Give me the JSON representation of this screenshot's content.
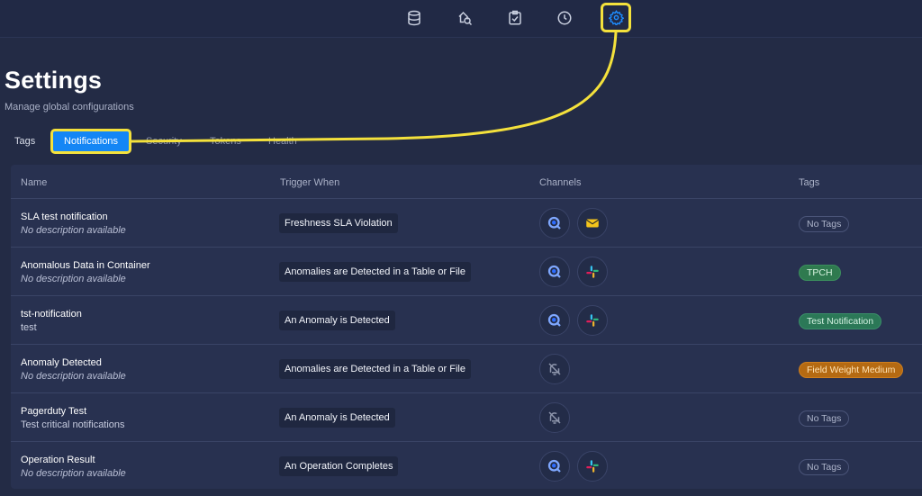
{
  "page": {
    "title": "Settings",
    "subtitle": "Manage global configurations"
  },
  "topnav": {
    "icons": [
      "database-icon",
      "explore-icon",
      "checklist-icon",
      "clock-icon",
      "gear-icon"
    ],
    "active": "gear-icon",
    "accent_color": "#1486f5",
    "highlight_color": "#f4e13c"
  },
  "tabs": [
    {
      "label": "Tags"
    },
    {
      "label": "Notifications",
      "active": true
    },
    {
      "label": "Security"
    },
    {
      "label": "Tokens"
    },
    {
      "label": "Health"
    }
  ],
  "table": {
    "headers": {
      "name": "Name",
      "trigger": "Trigger When",
      "channels": "Channels",
      "tags": "Tags"
    },
    "rows": [
      {
        "name": "SLA test notification",
        "description": "No description available",
        "trigger": "Freshness SLA Violation",
        "channels": [
          "in-app-icon",
          "email-icon"
        ],
        "tag": "No Tags"
      },
      {
        "name": "Anomalous Data in Container",
        "description": "No description available",
        "trigger": "Anomalies are Detected in a Table or File",
        "channels": [
          "in-app-icon",
          "slack-icon"
        ],
        "tag": "TPCH"
      },
      {
        "name": "tst-notification",
        "description": "test",
        "trigger": "An Anomaly is Detected",
        "channels": [
          "in-app-icon",
          "slack-icon"
        ],
        "tag": "Test Notification"
      },
      {
        "name": "Anomaly Detected",
        "description": "No description available",
        "trigger": "Anomalies are Detected in a Table or File",
        "channels": [
          "notifications-off-icon"
        ],
        "tag": "Field Weight Medium"
      },
      {
        "name": "Pagerduty Test",
        "description": "Test critical notifications",
        "trigger": "An Anomaly is Detected",
        "channels": [
          "notifications-off-icon"
        ],
        "tag": "No Tags"
      },
      {
        "name": "Operation Result",
        "description": "No description available",
        "trigger": "An Operation Completes",
        "channels": [
          "in-app-icon",
          "slack-icon"
        ],
        "tag": "No Tags"
      }
    ]
  },
  "colors": {
    "tag_tpch": "#2f7a4f",
    "tag_test_notification": "#2b7857",
    "tag_field_weight": "#b56a12"
  }
}
